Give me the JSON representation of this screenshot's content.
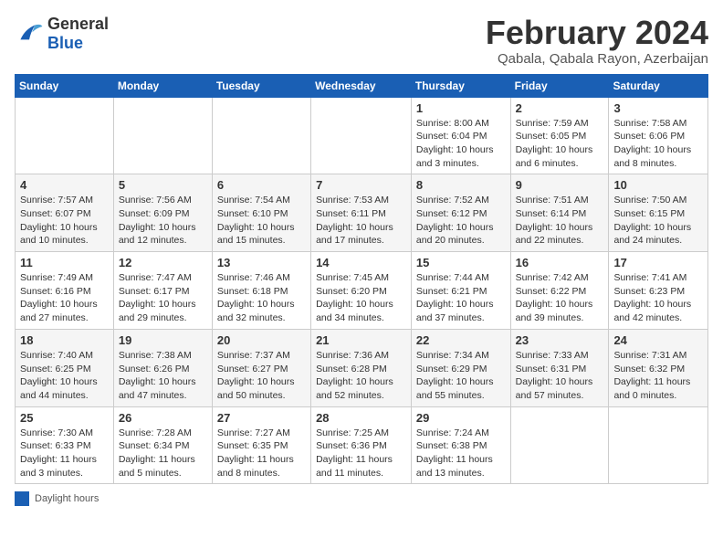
{
  "header": {
    "logo_line1": "General",
    "logo_line2": "Blue",
    "month_title": "February 2024",
    "location": "Qabala, Qabala Rayon, Azerbaijan"
  },
  "days_of_week": [
    "Sunday",
    "Monday",
    "Tuesday",
    "Wednesday",
    "Thursday",
    "Friday",
    "Saturday"
  ],
  "weeks": [
    [
      {
        "day": "",
        "info": ""
      },
      {
        "day": "",
        "info": ""
      },
      {
        "day": "",
        "info": ""
      },
      {
        "day": "",
        "info": ""
      },
      {
        "day": "1",
        "info": "Sunrise: 8:00 AM\nSunset: 6:04 PM\nDaylight: 10 hours\nand 3 minutes."
      },
      {
        "day": "2",
        "info": "Sunrise: 7:59 AM\nSunset: 6:05 PM\nDaylight: 10 hours\nand 6 minutes."
      },
      {
        "day": "3",
        "info": "Sunrise: 7:58 AM\nSunset: 6:06 PM\nDaylight: 10 hours\nand 8 minutes."
      }
    ],
    [
      {
        "day": "4",
        "info": "Sunrise: 7:57 AM\nSunset: 6:07 PM\nDaylight: 10 hours\nand 10 minutes."
      },
      {
        "day": "5",
        "info": "Sunrise: 7:56 AM\nSunset: 6:09 PM\nDaylight: 10 hours\nand 12 minutes."
      },
      {
        "day": "6",
        "info": "Sunrise: 7:54 AM\nSunset: 6:10 PM\nDaylight: 10 hours\nand 15 minutes."
      },
      {
        "day": "7",
        "info": "Sunrise: 7:53 AM\nSunset: 6:11 PM\nDaylight: 10 hours\nand 17 minutes."
      },
      {
        "day": "8",
        "info": "Sunrise: 7:52 AM\nSunset: 6:12 PM\nDaylight: 10 hours\nand 20 minutes."
      },
      {
        "day": "9",
        "info": "Sunrise: 7:51 AM\nSunset: 6:14 PM\nDaylight: 10 hours\nand 22 minutes."
      },
      {
        "day": "10",
        "info": "Sunrise: 7:50 AM\nSunset: 6:15 PM\nDaylight: 10 hours\nand 24 minutes."
      }
    ],
    [
      {
        "day": "11",
        "info": "Sunrise: 7:49 AM\nSunset: 6:16 PM\nDaylight: 10 hours\nand 27 minutes."
      },
      {
        "day": "12",
        "info": "Sunrise: 7:47 AM\nSunset: 6:17 PM\nDaylight: 10 hours\nand 29 minutes."
      },
      {
        "day": "13",
        "info": "Sunrise: 7:46 AM\nSunset: 6:18 PM\nDaylight: 10 hours\nand 32 minutes."
      },
      {
        "day": "14",
        "info": "Sunrise: 7:45 AM\nSunset: 6:20 PM\nDaylight: 10 hours\nand 34 minutes."
      },
      {
        "day": "15",
        "info": "Sunrise: 7:44 AM\nSunset: 6:21 PM\nDaylight: 10 hours\nand 37 minutes."
      },
      {
        "day": "16",
        "info": "Sunrise: 7:42 AM\nSunset: 6:22 PM\nDaylight: 10 hours\nand 39 minutes."
      },
      {
        "day": "17",
        "info": "Sunrise: 7:41 AM\nSunset: 6:23 PM\nDaylight: 10 hours\nand 42 minutes."
      }
    ],
    [
      {
        "day": "18",
        "info": "Sunrise: 7:40 AM\nSunset: 6:25 PM\nDaylight: 10 hours\nand 44 minutes."
      },
      {
        "day": "19",
        "info": "Sunrise: 7:38 AM\nSunset: 6:26 PM\nDaylight: 10 hours\nand 47 minutes."
      },
      {
        "day": "20",
        "info": "Sunrise: 7:37 AM\nSunset: 6:27 PM\nDaylight: 10 hours\nand 50 minutes."
      },
      {
        "day": "21",
        "info": "Sunrise: 7:36 AM\nSunset: 6:28 PM\nDaylight: 10 hours\nand 52 minutes."
      },
      {
        "day": "22",
        "info": "Sunrise: 7:34 AM\nSunset: 6:29 PM\nDaylight: 10 hours\nand 55 minutes."
      },
      {
        "day": "23",
        "info": "Sunrise: 7:33 AM\nSunset: 6:31 PM\nDaylight: 10 hours\nand 57 minutes."
      },
      {
        "day": "24",
        "info": "Sunrise: 7:31 AM\nSunset: 6:32 PM\nDaylight: 11 hours\nand 0 minutes."
      }
    ],
    [
      {
        "day": "25",
        "info": "Sunrise: 7:30 AM\nSunset: 6:33 PM\nDaylight: 11 hours\nand 3 minutes."
      },
      {
        "day": "26",
        "info": "Sunrise: 7:28 AM\nSunset: 6:34 PM\nDaylight: 11 hours\nand 5 minutes."
      },
      {
        "day": "27",
        "info": "Sunrise: 7:27 AM\nSunset: 6:35 PM\nDaylight: 11 hours\nand 8 minutes."
      },
      {
        "day": "28",
        "info": "Sunrise: 7:25 AM\nSunset: 6:36 PM\nDaylight: 11 hours\nand 11 minutes."
      },
      {
        "day": "29",
        "info": "Sunrise: 7:24 AM\nSunset: 6:38 PM\nDaylight: 11 hours\nand 13 minutes."
      },
      {
        "day": "",
        "info": ""
      },
      {
        "day": "",
        "info": ""
      }
    ]
  ],
  "legend": {
    "box_label": "Daylight hours"
  }
}
